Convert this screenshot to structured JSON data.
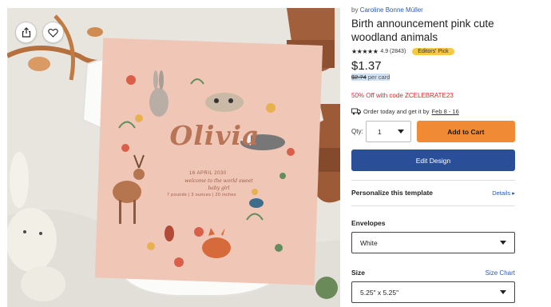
{
  "product": {
    "by_prefix": "by",
    "seller": "Caroline Bonne Müller",
    "title": "Birth announcement pink cute woodland animals",
    "stars": "★★★★★",
    "rating": "4.9 (2843)",
    "badge": "Editors' Pick",
    "price": "$1.37",
    "was_price": "$2.74",
    "per_card": " per card",
    "promo": "50% Off with code ZCELEBRATE23",
    "ship_prefix": "Order today and get it by",
    "ship_date": "Feb 8 - 16"
  },
  "purchase": {
    "qty_label": "Qty:",
    "qty_value": "1",
    "add_to_cart": "Add to Cart",
    "edit_design": "Edit Design"
  },
  "personalize": {
    "label": "Personalize this template",
    "details": "Details ▸"
  },
  "envelopes": {
    "label": "Envelopes",
    "selected": "White"
  },
  "size": {
    "label": "Size",
    "chart_link": "Size Chart",
    "selected": "5.25\" x 5.25\""
  },
  "card": {
    "name": "Olivia",
    "date": "16 APRIL 2030",
    "welcome": "welcome to the world sweet baby girl",
    "stats": "7 pounds | 3 ounces | 20 inches"
  },
  "icons": {
    "share": "share-icon",
    "favorite": "heart-icon",
    "truck": "truck-icon",
    "dropdown": "chevron-down-icon"
  },
  "colors": {
    "add_to_cart": "#f08a34",
    "edit_design": "#2a4f98",
    "promo": "#d22d2d",
    "badge": "#f6c945",
    "link": "#2a5ab8",
    "card_bg": "#f0c7b7"
  }
}
